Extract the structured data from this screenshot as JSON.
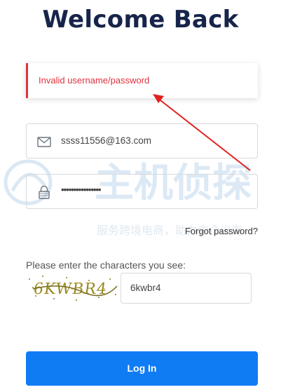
{
  "page": {
    "title": "Welcome Back"
  },
  "alert": {
    "message": "Invalid username/password",
    "color": "#e0323c"
  },
  "email_field": {
    "icon": "mail-icon",
    "value": "ssss11556@163.com"
  },
  "password_field": {
    "icon": "lock-icon",
    "value": "••••••••••••••••"
  },
  "forgot_link": "Forgot password?",
  "captcha": {
    "label": "Please enter the characters you see:",
    "image_text": "6KWBR4",
    "value": "6kwbr4"
  },
  "login_button": {
    "label": "Log In",
    "color": "#0f7cf4"
  },
  "watermark": {
    "line1": "主机侦探",
    "line2": "服务跨境电商，助力中企出海"
  },
  "annotation": {
    "icon": "red-arrow-icon",
    "color": "#e02020"
  }
}
